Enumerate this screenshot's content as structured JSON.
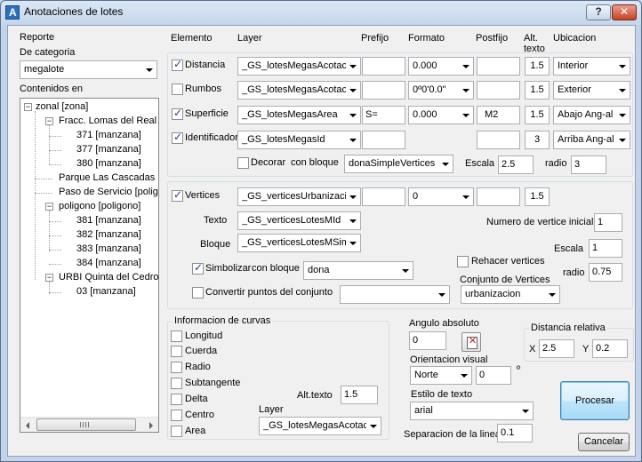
{
  "window": {
    "title": "Anotaciones de lotes",
    "help_label": "?",
    "close_label": "✕"
  },
  "reporte": {
    "group_title": "Reporte",
    "categoria_label": "De categoria",
    "categoria_value": "megalote",
    "contenidos_label": "Contenidos en",
    "tree": [
      {
        "label": "zonal [zona]",
        "expander": "−"
      },
      {
        "label": "Fracc. Lomas del Real [",
        "expander": "−"
      },
      {
        "label": "371 [manzana]"
      },
      {
        "label": "377 [manzana]"
      },
      {
        "label": "380 [manzana]"
      },
      {
        "label": "Parque Las Cascadas ["
      },
      {
        "label": "Paso de Servicio [poligo"
      },
      {
        "label": "poligono [poligono]",
        "expander": "−"
      },
      {
        "label": "381 [manzana]"
      },
      {
        "label": "382 [manzana]"
      },
      {
        "label": "383 [manzana]"
      },
      {
        "label": "384 [manzana]"
      },
      {
        "label": "URBI Quinta del Cedro [",
        "expander": "−"
      },
      {
        "label": "03 [manzana]"
      }
    ]
  },
  "headers": {
    "elemento": "Elemento",
    "layer": "Layer",
    "prefijo": "Prefijo",
    "formato": "Formato",
    "postfijo": "Postfijo",
    "alt_texto": "Alt.\ntexto",
    "alt_texto_line1": "Alt.",
    "alt_texto_line2": "texto",
    "ubicacion": "Ubicacion"
  },
  "rows": [
    {
      "label": "Distancia",
      "checked": true,
      "layer": "_GS_lotesMegasAcotaci",
      "prefijo": "",
      "formato": "0.000",
      "postfijo": "",
      "alt": "1.5",
      "ubicacion": "Interior"
    },
    {
      "label": "Rumbos",
      "checked": false,
      "layer": "_GS_lotesMegasAcotaci",
      "prefijo": "",
      "formato": "0º0'0.0\"",
      "postfijo": "",
      "alt": "1.5",
      "ubicacion": "Exterior"
    },
    {
      "label": "Superficie",
      "checked": true,
      "layer": "_GS_lotesMegasArea",
      "prefijo": "S=",
      "formato": "0.000",
      "postfijo": "M2",
      "alt": "1.5",
      "ubicacion": "Abajo Ang-al"
    },
    {
      "label": "Identificador",
      "checked": true,
      "layer": "_GS_lotesMegasId",
      "prefijo": "",
      "postfijo": "",
      "alt": "3",
      "ubicacion": "Arriba Ang-al"
    }
  ],
  "decorar": {
    "checked": false,
    "label": "Decorar",
    "con_bloque_label": "con bloque",
    "bloque_value": "donaSimpleVertices",
    "escala_label": "Escala",
    "escala_value": "2.5",
    "radio_label": "radio",
    "radio_value": "3"
  },
  "vertices": {
    "checked": true,
    "label": "Vertices",
    "layer": "_GS_verticesUrbanizacio",
    "prefijo": "",
    "formato": "0",
    "postfijo": "",
    "alt": "1.5",
    "texto_label": "Texto",
    "texto_layer": "_GS_verticesLotesMId",
    "bloque_label": "Bloque",
    "bloque_layer": "_GS_verticesLotesMSim",
    "num_inicial_label": "Numero de vertice inicial",
    "num_inicial_value": "1",
    "escala_label": "Escala",
    "escala_value": "1",
    "radio_label": "radio",
    "radio_value": "0.75",
    "simbolizar_checked": true,
    "simbolizar_label": "Simbolizar",
    "simbolizar_con_bloque": "con bloque",
    "simbolizar_bloque": "dona",
    "rehacer_checked": false,
    "rehacer_label": "Rehacer vertices",
    "convertir_checked": false,
    "convertir_label": "Convertir puntos del conjunto",
    "convertir_value": "",
    "conjunto_label": "Conjunto de Vertices",
    "conjunto_value": "urbanizacion"
  },
  "curvas": {
    "group_title": "Informacion de curvas",
    "items": [
      {
        "label": "Longitud",
        "checked": false
      },
      {
        "label": "Cuerda",
        "checked": false
      },
      {
        "label": "Radio",
        "checked": false
      },
      {
        "label": "Subtangente",
        "checked": false
      },
      {
        "label": "Delta",
        "checked": false
      },
      {
        "label": "Centro",
        "checked": false
      },
      {
        "label": "Area",
        "checked": false
      }
    ],
    "alt_texto_label": "Alt.texto",
    "alt_texto_value": "1.5",
    "layer_label": "Layer",
    "layer_value": "_GS_lotesMegasAcotaci"
  },
  "angulo": {
    "label": "Angulo absoluto",
    "value": "0",
    "orientacion_label": "Orientacion visual",
    "orientacion_value": "Norte",
    "orientacion_offset": "0",
    "degree_symbol": "º",
    "estilo_label": "Estilo de texto",
    "estilo_value": "arial",
    "separacion_label": "Separacion de la linea",
    "separacion_value": "0.1"
  },
  "distancia_relativa": {
    "group_title": "Distancia relativa",
    "x_label": "X",
    "x_value": "2.5",
    "y_label": "Y",
    "y_value": "0.2"
  },
  "buttons": {
    "procesar": "Procesar",
    "cancelar": "Cancelar"
  }
}
